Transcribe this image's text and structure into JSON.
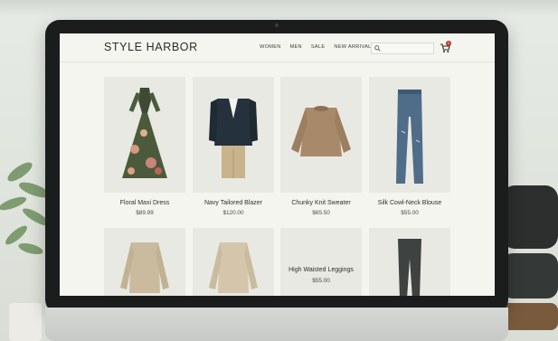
{
  "store": {
    "logo": "STYLE HARBOR",
    "nav": [
      "WOMEN",
      "MEN",
      "SALE",
      "NEW ARRIVALS"
    ],
    "search_placeholder": "",
    "cart_count": "1"
  },
  "products_row1": [
    {
      "name": "Floral Maxi Dress",
      "price": "$89.99"
    },
    {
      "name": "Navy Tailored Blazer",
      "price": "$120.00"
    },
    {
      "name": "Chunky Knit Sweater",
      "price": "$65.50"
    },
    {
      "name": "Silk Cowl-Neck Blouse",
      "price": "$55.00"
    }
  ],
  "products_row2": [
    {
      "name": "",
      "price": ""
    },
    {
      "name": "",
      "price": ""
    },
    {
      "name": "High Waisted Leggings",
      "price": "$55.00"
    },
    {
      "name": "",
      "price": ""
    }
  ],
  "colors": {
    "background": "#f4f5ef",
    "accent_badge": "#c0392b"
  }
}
